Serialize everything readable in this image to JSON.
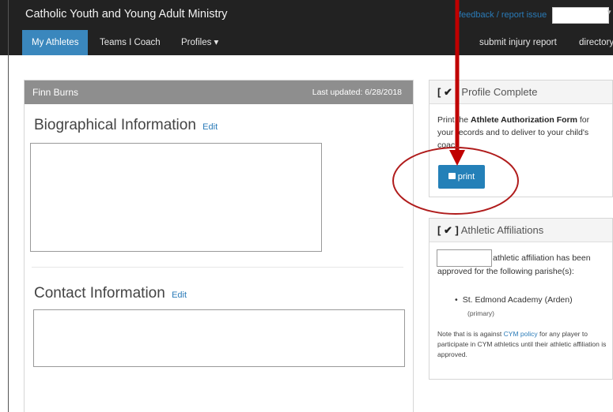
{
  "header": {
    "brand": "Catholic Youth and Young Adult Ministry",
    "feedback_link": "feedback / report issue",
    "user_caret": "▾"
  },
  "nav": {
    "my_athletes": "My Athletes",
    "teams_i_coach": "Teams I Coach",
    "profiles": "Profiles ▾",
    "submit_injury": "submit injury report",
    "directory": "directory"
  },
  "athlete": {
    "name": "Finn Burns",
    "last_updated": "Last updated: 6/28/2018",
    "bio_title": "Biographical Information",
    "contact_title": "Contact Information",
    "edit_label": "Edit"
  },
  "profile_panel": {
    "check": "[ ✔ ]",
    "title": "Profile Complete",
    "text_pre": "Print the ",
    "text_bold": "Athlete Authorization Form",
    "text_post": " for your records and to deliver to your child's coach.",
    "print_label": "print"
  },
  "affiliation_panel": {
    "check": "[ ✔ ]",
    "title": "Athletic Affiliations",
    "text1": "athletic affiliation has been",
    "text2": "approved for the following parishe(s):",
    "parishes": [
      {
        "name": "St. Edmond Academy (Arden)",
        "note": "(primary)"
      }
    ],
    "policy_pre": "Note that is is against ",
    "policy_link": "CYM policy",
    "policy_post": " for any player to participate in CYM athletics until their athletic affiliation is approved."
  },
  "colors": {
    "topbar": "#222222",
    "nav_active": "#3a87bd",
    "print_button": "#2480b8",
    "annotation_red": "#c00000"
  }
}
